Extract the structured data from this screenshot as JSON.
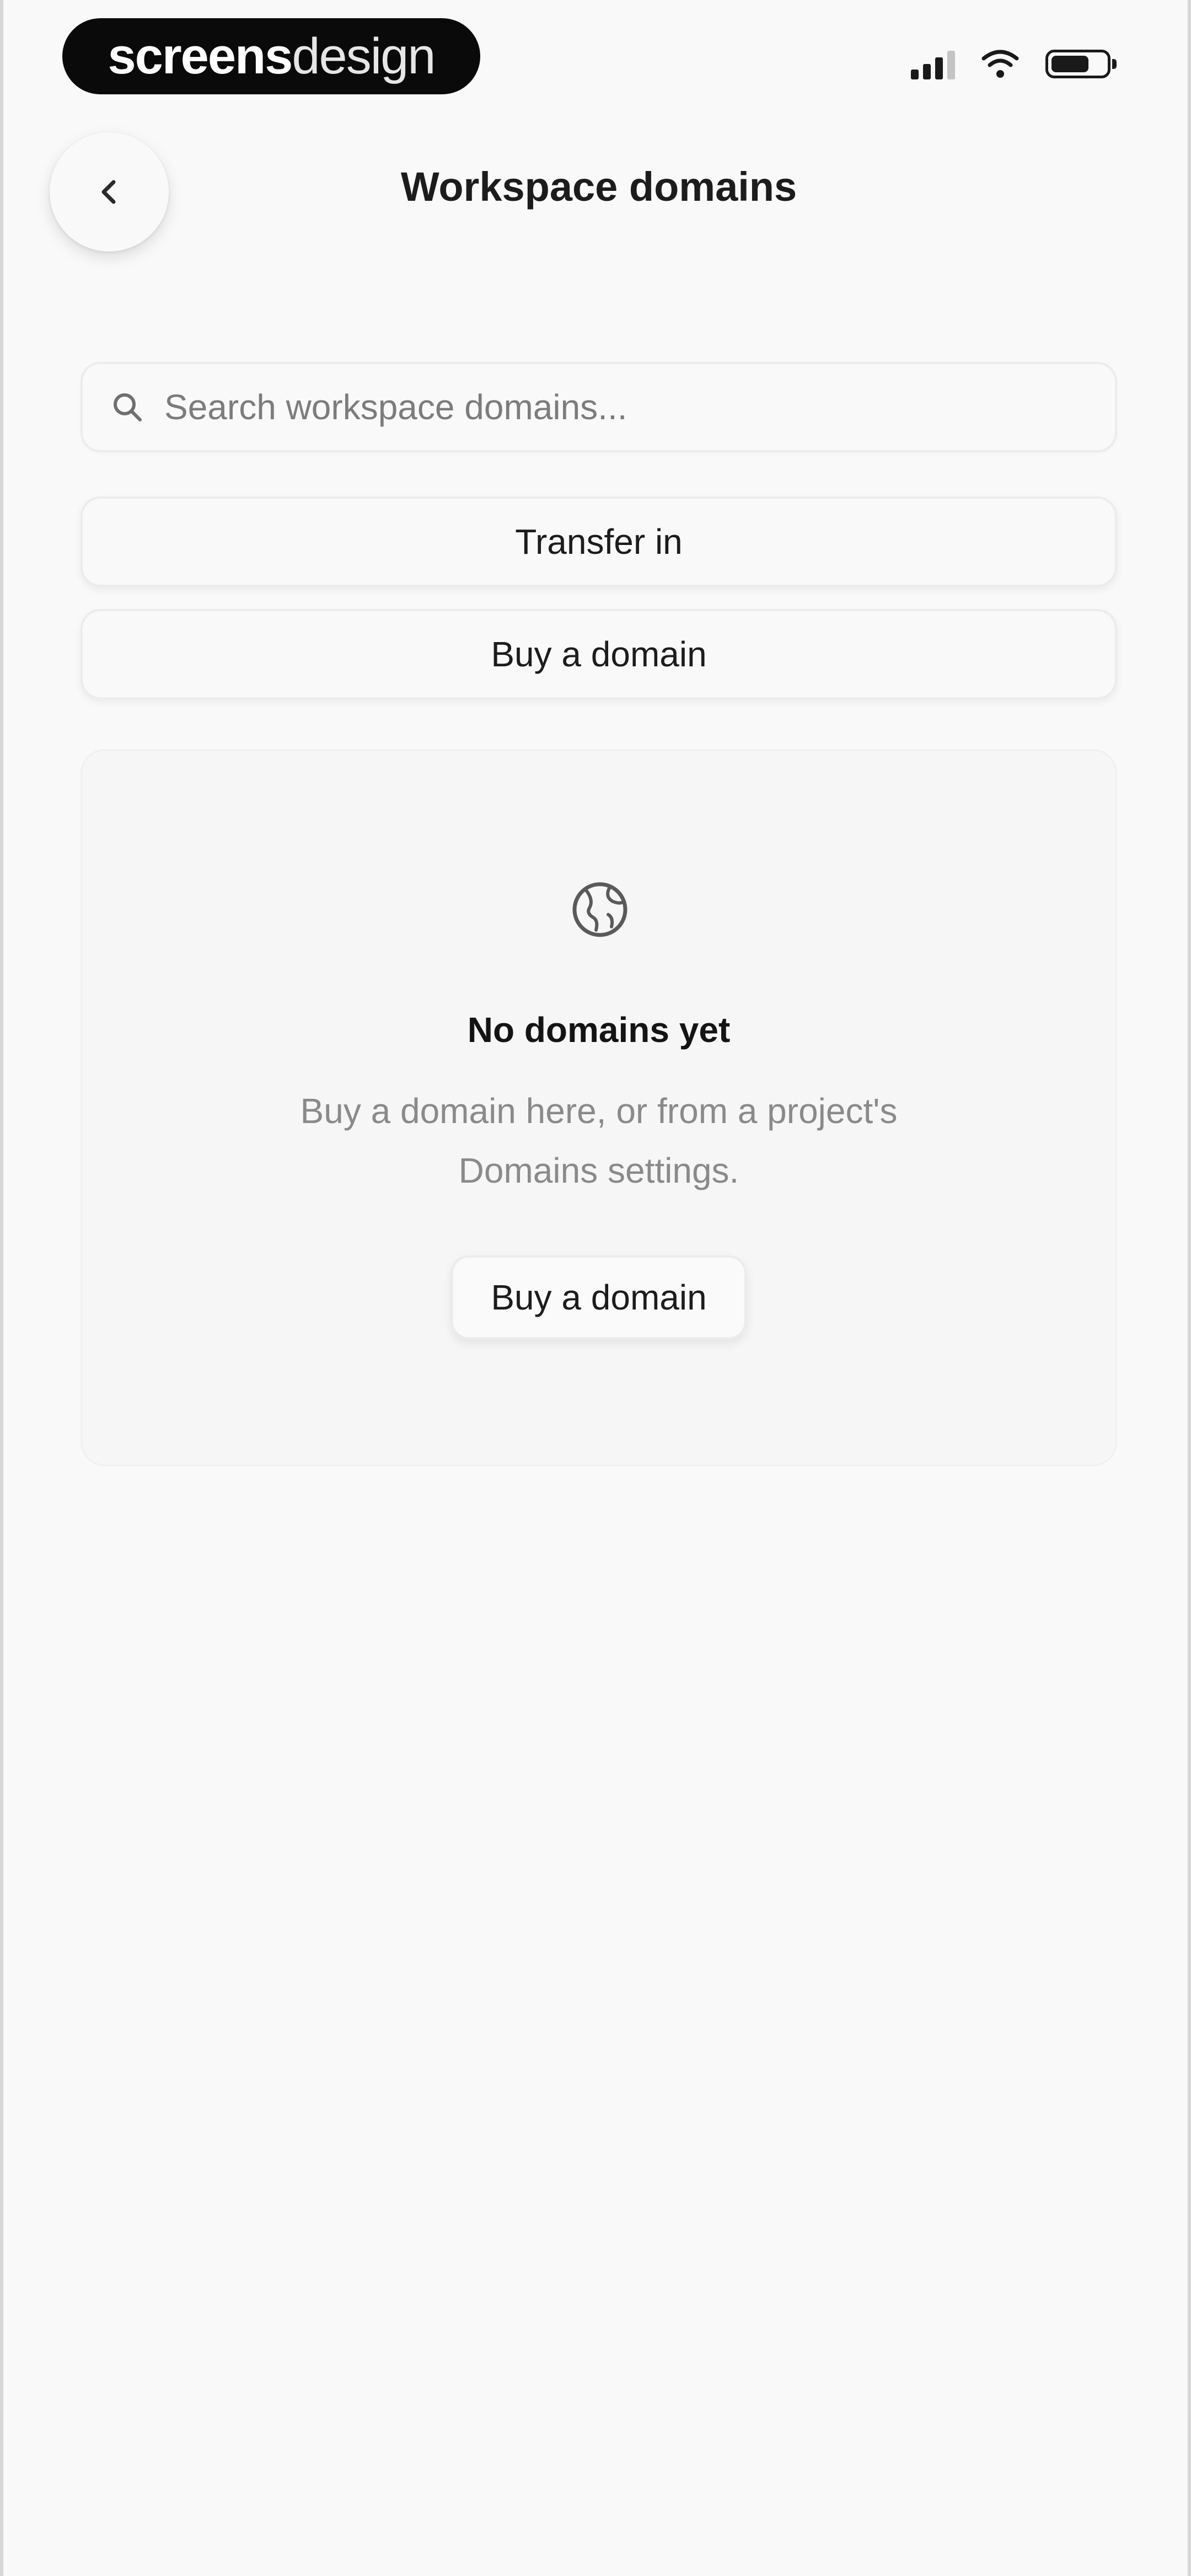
{
  "status_bar": {
    "brand_strong": "screens",
    "brand_light": "design",
    "signal_icon": "cellular-signal-icon",
    "wifi_icon": "wifi-icon",
    "battery_icon": "battery-icon"
  },
  "header": {
    "back_icon": "chevron-left-icon",
    "title": "Workspace domains"
  },
  "search": {
    "icon": "search-icon",
    "placeholder": "Search workspace domains...",
    "value": ""
  },
  "actions": {
    "transfer_label": "Transfer in",
    "buy_label": "Buy a domain"
  },
  "empty_state": {
    "icon": "globe-icon",
    "title": "No domains yet",
    "message": "Buy a domain here, or from a project's Domains settings.",
    "cta_label": "Buy a domain"
  },
  "colors": {
    "background": "#f9f9f9",
    "text_primary": "#171717",
    "text_muted": "#8a8a8a",
    "border": "#ececec",
    "brand_pill": "#0a0a0a"
  }
}
